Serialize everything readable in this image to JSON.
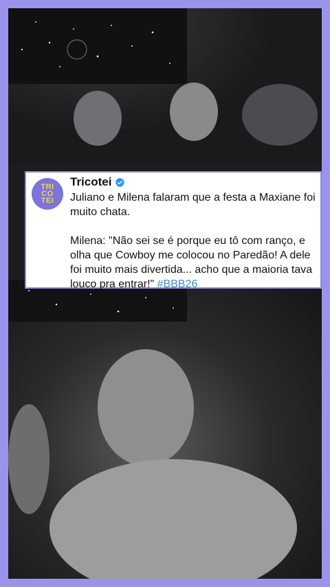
{
  "post": {
    "author": "Tricotei",
    "avatar_text": [
      "TRI",
      "CO",
      "TEI"
    ],
    "verified_icon": "verified-badge-icon",
    "paragraph1": "Juliano e Milena falaram que a festa a Maxiane foi muito chata.",
    "paragraph2": "Milena: \"Não sei se é porque eu tô com ranço, e olha que Cowboy me colocou no Paredão! A dele foi muito mais divertida... acho que a maioria tava louco pra entrar!\"",
    "hashtag": "#BBB26"
  },
  "colors": {
    "background": "#9b93ea",
    "avatar": "#7d73dc",
    "avatar_text": "#f3d64a",
    "hashtag": "#3b8ec2"
  }
}
